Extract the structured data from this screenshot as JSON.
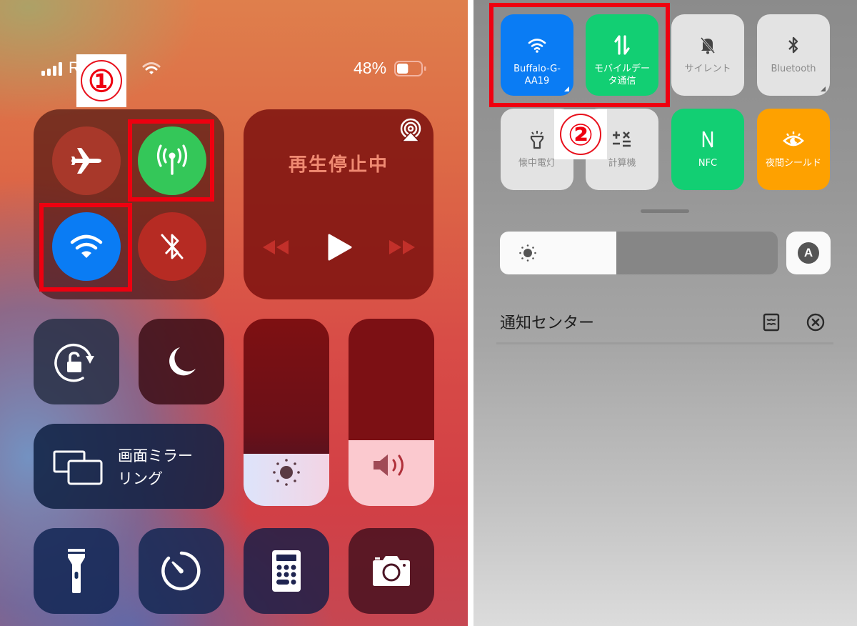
{
  "ios": {
    "status_bar": {
      "carrier": "Rakuten",
      "battery_percent": "48%",
      "battery_level": 0.48
    },
    "annotation_badge": "①",
    "connectivity": {
      "airplane_mode": {
        "label": "airplane-mode",
        "active": false
      },
      "cellular_data": {
        "label": "cellular-data",
        "active": true,
        "highlighted": true
      },
      "wifi": {
        "label": "wifi",
        "active": true,
        "highlighted": true
      },
      "bluetooth": {
        "label": "bluetooth",
        "active": false
      }
    },
    "now_playing": {
      "status": "再生停止中"
    },
    "screen_mirroring": {
      "label_line1": "画面ミラー",
      "label_line2": "リング"
    },
    "brightness_level": 0.28,
    "volume_level": 0.35,
    "colors": {
      "cellular_green": "#34c759",
      "wifi_blue": "#0a7cf4",
      "highlight_red": "#ee0010"
    }
  },
  "android": {
    "annotation_badge": "②",
    "tiles_row1": [
      {
        "id": "wifi",
        "label_line1": "Buffalo-G-",
        "label_line2": "AA19",
        "state": "on",
        "color": "#0a7cf4",
        "highlighted": true
      },
      {
        "id": "mobile-data",
        "label_line1": "モバイルデー",
        "label_line2": "タ通信",
        "state": "on",
        "color": "#12cf73",
        "highlighted": true
      },
      {
        "id": "silent",
        "label_line1": "サイレント",
        "label_line2": "",
        "state": "off"
      },
      {
        "id": "bluetooth",
        "label_line1": "Bluetooth",
        "label_line2": "",
        "state": "off"
      }
    ],
    "tiles_row2": [
      {
        "id": "flashlight",
        "label_line1": "懐中電灯",
        "state": "off"
      },
      {
        "id": "calculator",
        "label_line1": "計算機",
        "state": "off"
      },
      {
        "id": "nfc",
        "label_line1": "NFC",
        "state": "on",
        "color": "#12cf73"
      },
      {
        "id": "night-shield",
        "label_line1": "夜間シールド",
        "state": "on",
        "color": "#fea100"
      }
    ],
    "brightness_level": 0.42,
    "auto_brightness_label": "A",
    "notification_center": {
      "title": "通知センター"
    }
  }
}
